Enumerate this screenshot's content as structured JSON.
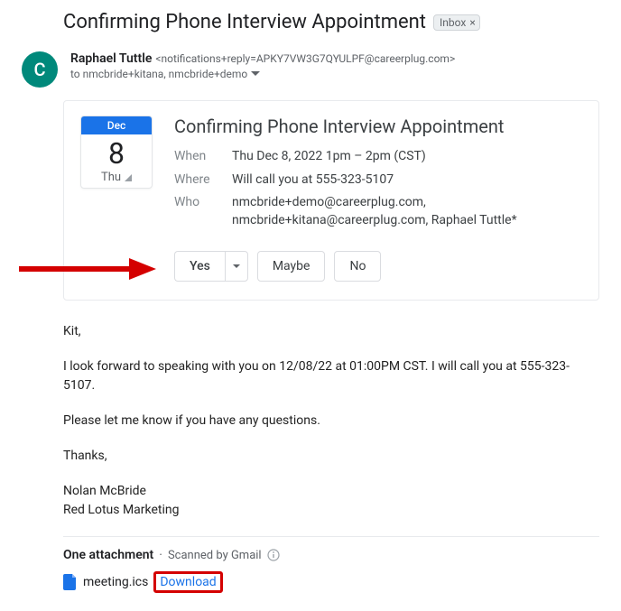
{
  "subject": "Confirming Phone Interview Appointment",
  "label": {
    "name": "Inbox"
  },
  "avatar_letter": "C",
  "sender": {
    "name": "Raphael Tuttle",
    "email": "<notifications+reply=APKY7VW3G7QYULPF@careerplug.com>"
  },
  "recipients_line": "to nmcbride+kitana, nmcbride+demo",
  "calendar": {
    "month": "Dec",
    "day": "8",
    "dow": "Thu"
  },
  "event": {
    "title": "Confirming Phone Interview Appointment",
    "when_label": "When",
    "when_value": "Thu Dec 8, 2022 1pm – 2pm (CST)",
    "where_label": "Where",
    "where_value": "Will call you at 555-323-5107",
    "who_label": "Who",
    "who_value": "nmcbride+demo@careerplug.com, nmcbride+kitana@careerplug.com, Raphael Tuttle*"
  },
  "rsvp": {
    "yes": "Yes",
    "maybe": "Maybe",
    "no": "No"
  },
  "body": {
    "greeting": "Kit,",
    "line1": "I look forward to speaking with you on 12/08/22 at 01:00PM CST. I will call you at 555-323-5107.",
    "line2": "Please let me know if you have any questions.",
    "thanks": "Thanks,",
    "sig_name": "Nolan McBride",
    "sig_company": "Red Lotus Marketing"
  },
  "attachments": {
    "header_count": "One attachment",
    "scanned": "Scanned by Gmail",
    "file_name": "meeting.ics",
    "download": "Download"
  }
}
